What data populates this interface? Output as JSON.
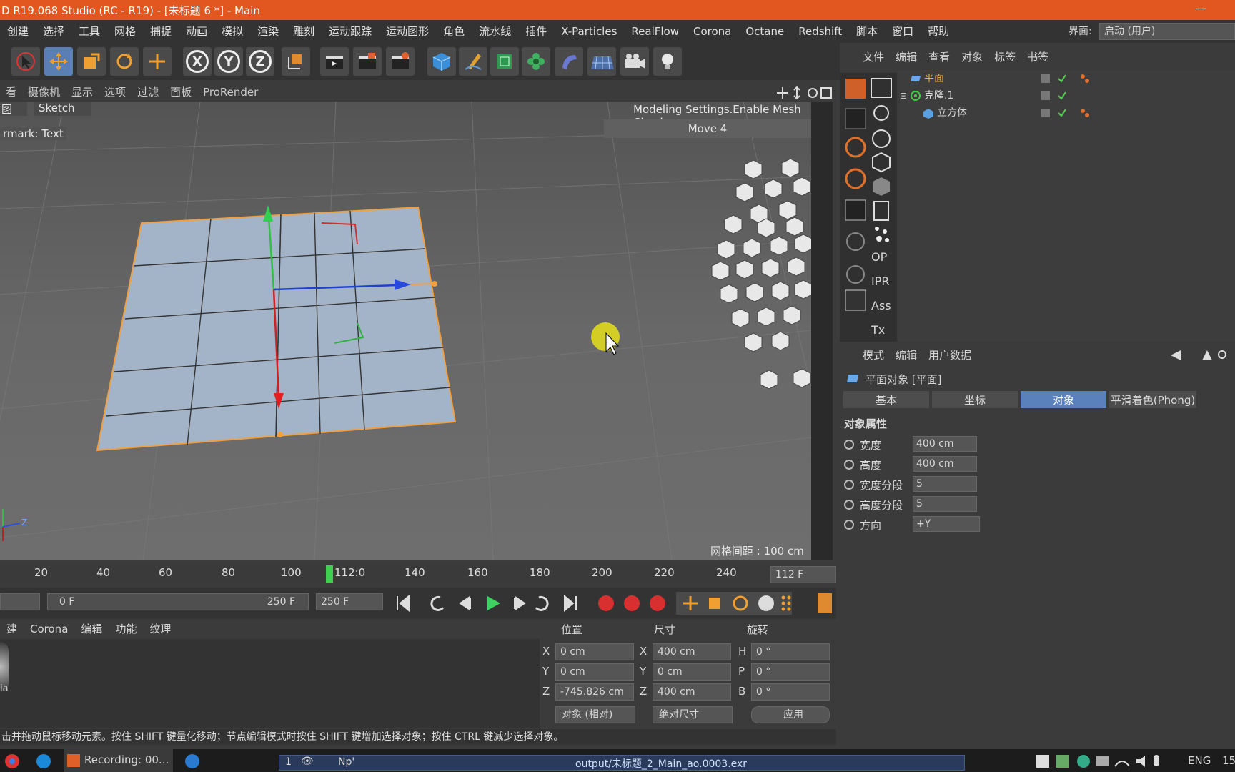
{
  "window": {
    "title": "D R19.068 Studio (RC - R19) - [未标题 6 *] - Main",
    "minimize_glyph": "—"
  },
  "menubar": {
    "items": [
      "创建",
      "选择",
      "工具",
      "网格",
      "捕捉",
      "动画",
      "模拟",
      "渲染",
      "雕刻",
      "运动跟踪",
      "运动图形",
      "角色",
      "流水线",
      "插件",
      "X-Particles",
      "RealFlow",
      "Corona",
      "Octane",
      "Redshift",
      "脚本",
      "窗口",
      "帮助"
    ],
    "layout_label": "界面:",
    "layout_value": "启动 (用户)"
  },
  "toolbar": {
    "axis_x": "X",
    "axis_y": "Y",
    "axis_z": "Z"
  },
  "viewport": {
    "menu": [
      "看",
      "摄像机",
      "显示",
      "选项",
      "过滤",
      "面板",
      "ProRender"
    ],
    "tab_left": "图",
    "tab_sketch": "Sketch",
    "hud_mesh_check": "Modeling Settings.Enable Mesh Check",
    "hud_move": "Move 4",
    "watermark": "rmark: Text",
    "grid_spacing": "网格间距 : 100 cm",
    "axis_gizmo_z": "Z"
  },
  "timeline": {
    "ticks": [
      "20",
      "40",
      "60",
      "80",
      "100",
      "112:0",
      "140",
      "160",
      "180",
      "200",
      "220",
      "240"
    ],
    "current_frame": "112 F",
    "range_start": "0 F",
    "range_end": "250 F",
    "max_frame": "250 F"
  },
  "material_menu": [
    "建",
    "Corona",
    "编辑",
    "功能",
    "纹理"
  ],
  "material_label": "ia",
  "coords": {
    "headers": {
      "position": "位置",
      "size": "尺寸",
      "rotation": "旋转"
    },
    "pos": {
      "x": "0 cm",
      "y": "0 cm",
      "z": "-745.826 cm"
    },
    "size": {
      "x": "400 cm",
      "y": "0 cm",
      "z": "400 cm"
    },
    "rot": {
      "h": "0 °",
      "p": "0 °",
      "b": "0 °"
    },
    "labels": {
      "x": "X",
      "y": "Y",
      "z": "Z",
      "h": "H",
      "p": "P",
      "b": "B"
    },
    "mode_object": "对象 (相对)",
    "mode_size": "绝对尺寸",
    "apply": "应用"
  },
  "statusbar": "击并拖动鼠标移动元素。按住 SHIFT 键量化移动；节点编辑模式时按住 SHIFT 键增加选择对象；按住 CTRL 键减少选择对象。",
  "object_manager": {
    "menu": [
      "文件",
      "编辑",
      "查看",
      "对象",
      "标签",
      "书签"
    ],
    "side_labels": {
      "op": "OP",
      "ipr": "IPR",
      "ass": "Ass",
      "tx": "Tx"
    },
    "tree": [
      {
        "name": "平面",
        "indent": 1,
        "selected": true
      },
      {
        "name": "克隆.1",
        "indent": 0,
        "selected": false
      },
      {
        "name": "立方体",
        "indent": 2,
        "selected": false
      }
    ]
  },
  "attributes": {
    "menu": [
      "模式",
      "编辑",
      "用户数据"
    ],
    "object_title": "平面对象 [平面]",
    "tabs": [
      "基本",
      "坐标",
      "对象",
      "平滑着色(Phong)"
    ],
    "active_tab": "对象",
    "section": "对象属性",
    "props": [
      {
        "label": "宽度",
        "value": "400 cm"
      },
      {
        "label": "高度",
        "value": "400 cm"
      },
      {
        "label": "宽度分段",
        "value": "5"
      },
      {
        "label": "高度分段",
        "value": "5"
      },
      {
        "label": "方向",
        "value": "+Y"
      }
    ]
  },
  "taskbar": {
    "recording": "Recording: 00...",
    "layer_num": "1",
    "np": "Np'",
    "output_file": "output/未标题_2_Main_ao.0003.exr",
    "lang": "ENG",
    "clock": "15"
  },
  "colors": {
    "titlebar": "#e2561f",
    "accent": "#5b81bd",
    "selection": "#f0a040"
  }
}
